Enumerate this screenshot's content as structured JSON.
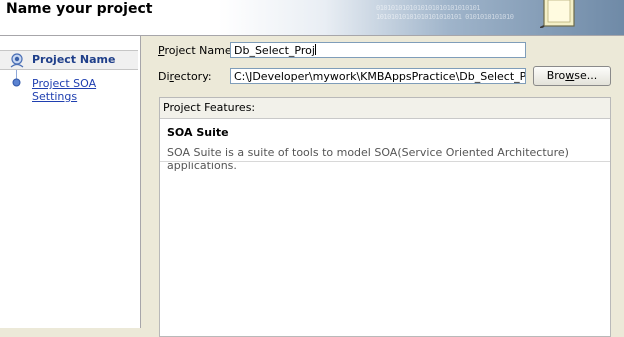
{
  "header": {
    "title": "Name your project",
    "watermark": "0101010101010101010101010101 10101010101010101010101 0101010101010"
  },
  "sidebar": {
    "items": [
      {
        "label": "Project Name",
        "active": true
      },
      {
        "label": "Project SOA Settings",
        "active": false
      }
    ]
  },
  "form": {
    "project_name": {
      "label_key": "P",
      "label_rest": "roject Name:",
      "value": "Db_Select_Proj"
    },
    "directory": {
      "label_pre": "Di",
      "label_key": "r",
      "label_rest": "ectory:",
      "value": "C:\\JDeveloper\\mywork\\KMBAppsPractice\\Db_Select_Proj"
    },
    "browse": {
      "label_pre": "Bro",
      "label_key": "w",
      "label_rest": "se..."
    }
  },
  "features": {
    "header": "Project Features:",
    "items": [
      {
        "name": "SOA Suite",
        "description": "SOA Suite is a suite of tools to model SOA(Service Oriented Architecture) applications."
      }
    ]
  },
  "colors": {
    "accent": "#1f3f8a",
    "link": "#1f3fb0",
    "window_bg": "#ece9d8"
  },
  "icons": {
    "step_active": "step-indicator-active-icon",
    "step": "step-indicator-icon",
    "wizard": "wizard-graphic-icon"
  }
}
